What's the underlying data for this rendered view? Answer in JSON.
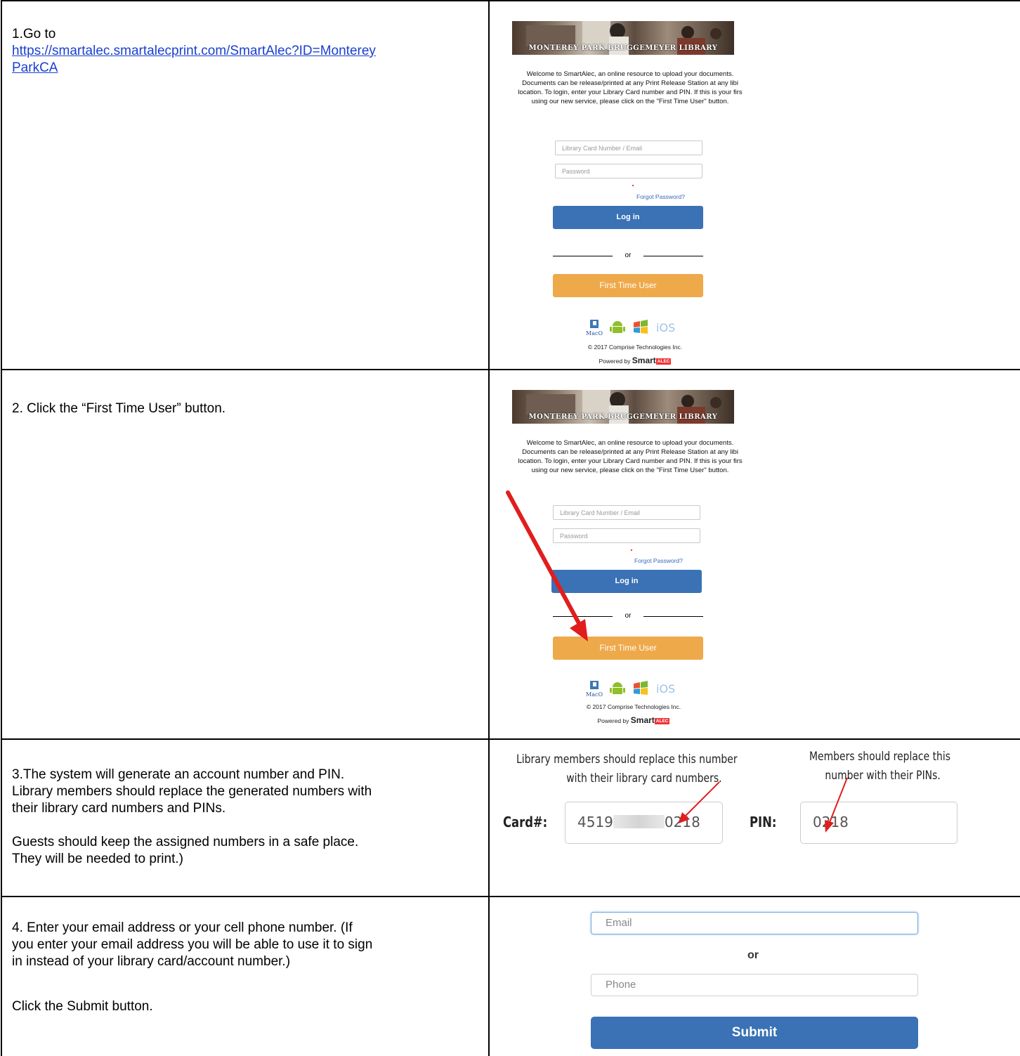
{
  "steps": [
    {
      "text_prefix": "1.Go to",
      "link": "https://smartalec.smartalecprint.com/SmartAlec?ID=MontereyParkCA",
      "link_line1": "https://smartalec.smartalecprint.com/SmartAlec?ID=Monterey",
      "link_line2": "ParkCA"
    },
    {
      "text": "2. Click the  “First Time User” button."
    },
    {
      "para1_line1": "3.The system will generate an account number and PIN.",
      "para1_line2": "Library members should replace the generated numbers with",
      "para1_line3": "their library card numbers and PINs.",
      "para2_line1": "Guests should keep the assigned numbers in a safe place.",
      "para2_line2": "They will be needed to print.)"
    },
    {
      "para1_line1": "4. Enter your email address or your cell phone number. (If",
      "para1_line2": "you enter your email address you will be able to use it to sign",
      "para1_line3": "in instead of your library card/account number.)",
      "para2": "Click the Submit button."
    }
  ],
  "login": {
    "banner": "MONTEREY PARK BRUGGEMEYER LIBRARY",
    "welcome_line1": "Welcome to SmartAlec, an online resource to upload your documents.",
    "welcome_line2": "Documents can be release/printed at any Print Release Station at any libi",
    "welcome_line3": "location. To login, enter your Library Card number and PIN. If this is your firs",
    "welcome_line4": "using our new service, please click on the \"First Time User\" button.",
    "card_placeholder": "Library Card Number / Email",
    "password_placeholder": "Password",
    "forgot": "Forgot Password?",
    "login_button": "Log in",
    "or": "or",
    "first_time_button": "First Time User",
    "os_icons": [
      "macos-icon",
      "android-icon",
      "windows-icon",
      "ios-icon"
    ],
    "mac_label": "MacOS",
    "ios_label": "iOS",
    "copyright": "© 2017 Comprise Technologies Inc.",
    "powered_prefix": "Powered by",
    "powered_brand": "Smart",
    "powered_badge": "ALEC"
  },
  "account": {
    "hint_card_line1": "Library members should replace this number",
    "hint_card_line2": "with their library card numbers.",
    "hint_pin_line1": "Members should replace this",
    "hint_pin_line2": "number with their PINs.",
    "card_label": "Card#:",
    "card_start": "4519",
    "card_end": "0218",
    "pin_label": "PIN:",
    "pin_value": "0218"
  },
  "contact": {
    "email_placeholder": "Email",
    "or": "or",
    "phone_placeholder": "Phone",
    "submit": "Submit"
  },
  "colors": {
    "link": "#1a3fd1",
    "primary_button": "#3a72b5",
    "first_time_button": "#eea94a",
    "arrow": "#e11d1d"
  }
}
